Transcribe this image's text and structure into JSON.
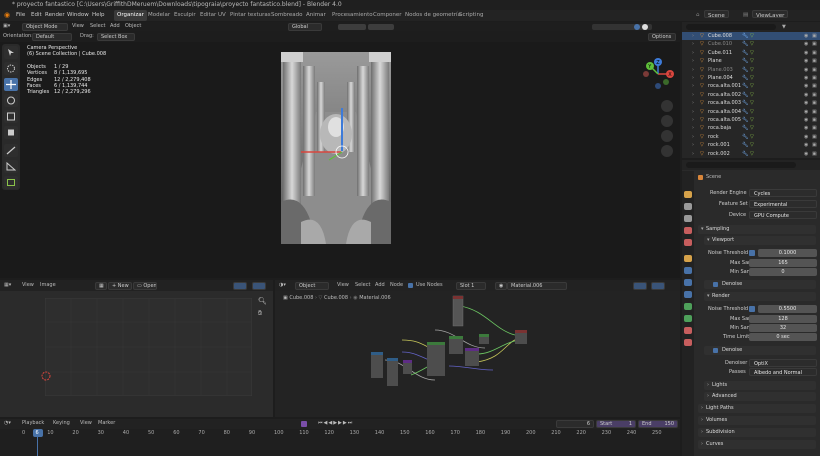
{
  "window": {
    "title": "* proyecto fantastico [C:\\Users\\GriffithDMeruem\\Downloads\\tipograia\\proyecto fantastico.blend] - Blender 4.0"
  },
  "menubar": {
    "menus": [
      "File",
      "Edit",
      "Render",
      "Window",
      "Help"
    ],
    "workspaces": [
      "Organizar",
      "Modelar",
      "Esculpir",
      "Editar UV",
      "Pintar texturas",
      "Sombreado",
      "Animar",
      "Procesamiento",
      "Componer",
      "Nodos de geometría",
      "Scripting"
    ],
    "scene": "Scene",
    "view_layer": "ViewLayer"
  },
  "viewport": {
    "mode": "Object Mode",
    "menus": [
      "View",
      "Select",
      "Add",
      "Object"
    ],
    "transform": "Global",
    "orientation_label": "Orientation:",
    "orientation_value": "Default",
    "drag_label": "Drag:",
    "drag_value": "Select Box",
    "options": "Options",
    "camera_title": "Camera Perspective",
    "camera_sub": "(6) Scene Collection | Cube.008",
    "stats": [
      {
        "label": "Objects",
        "value": "1 / 29"
      },
      {
        "label": "Vertices",
        "value": "8 / 1,139,695"
      },
      {
        "label": "Edges",
        "value": "12 / 2,279,408"
      },
      {
        "label": "Faces",
        "value": "6 / 1,139,744"
      },
      {
        "label": "Triangles",
        "value": "12 / 2,279,296"
      }
    ],
    "gizmo": {
      "x": "X",
      "y": "Y",
      "z": "Z"
    }
  },
  "outliner": {
    "items": [
      {
        "name": "Cube.008",
        "selected": true,
        "dim": false
      },
      {
        "name": "Cube.010",
        "selected": false,
        "dim": true
      },
      {
        "name": "Cube.011",
        "selected": false,
        "dim": false
      },
      {
        "name": "Plane",
        "selected": false,
        "dim": false
      },
      {
        "name": "Plane.003",
        "selected": false,
        "dim": true
      },
      {
        "name": "Plane.004",
        "selected": false,
        "dim": false
      },
      {
        "name": "roca.alta.001",
        "selected": false,
        "dim": false
      },
      {
        "name": "roca.alta.002",
        "selected": false,
        "dim": false
      },
      {
        "name": "roca.alta.003",
        "selected": false,
        "dim": false
      },
      {
        "name": "roca.alta.004",
        "selected": false,
        "dim": false
      },
      {
        "name": "roca.alta.005",
        "selected": false,
        "dim": false
      },
      {
        "name": "roca.baja",
        "selected": false,
        "dim": false
      },
      {
        "name": "rock",
        "selected": false,
        "dim": false
      },
      {
        "name": "rock.001",
        "selected": false,
        "dim": false
      },
      {
        "name": "rock.002",
        "selected": false,
        "dim": false
      }
    ]
  },
  "properties": {
    "header": "Scene",
    "render_engine_label": "Render Engine",
    "render_engine": "Cycles",
    "feature_set_label": "Feature Set",
    "feature_set": "Experimental",
    "device_label": "Device",
    "device": "GPU Compute",
    "sampling": "Sampling",
    "viewport": "Viewport",
    "noise_threshold_label": "Noise Threshold",
    "viewport_noise_threshold": "0.1000",
    "max_samples_label": "Max Samples",
    "viewport_max_samples": "165",
    "min_samples_label": "Min Samples",
    "viewport_min_samples": "0",
    "denoise": "Denoise",
    "render": "Render",
    "render_noise_threshold": "0.5500",
    "render_max_samples": "128",
    "render_min_samples": "32",
    "time_limit_label": "Time Limit",
    "time_limit": "0 sec",
    "denoiser_label": "Denoiser",
    "denoiser": "OptiX",
    "passes_label": "Passes",
    "passes": "Albedo and Normal",
    "lights": "Lights",
    "advanced": "Advanced",
    "light_paths": "Light Paths",
    "volumes": "Volumes",
    "subdivision": "Subdivision",
    "curves": "Curves"
  },
  "image_editor": {
    "menus": [
      "View",
      "Image"
    ],
    "new": "New",
    "open": "Open"
  },
  "node_editor": {
    "object": "Object",
    "menus": [
      "View",
      "Select",
      "Add",
      "Node"
    ],
    "use_nodes": "Use Nodes",
    "slot": "Slot 1",
    "material": "Material.006",
    "breadcrumb": [
      "Cube.008",
      "Cube.008",
      "Material.006"
    ]
  },
  "timeline": {
    "menus": [
      "Playback",
      "Keying",
      "View",
      "Marker"
    ],
    "current_frame": "6",
    "start_label": "Start",
    "start": "1",
    "end_label": "End",
    "end": "150",
    "ticks": [
      "0",
      "6",
      "10",
      "20",
      "30",
      "40",
      "50",
      "60",
      "70",
      "80",
      "90",
      "100",
      "110",
      "120",
      "130",
      "140",
      "150",
      "160",
      "170",
      "180",
      "190",
      "200",
      "210",
      "220",
      "230",
      "240",
      "250"
    ]
  },
  "colors": {
    "accent": "#4872a8",
    "selection": "#324e74",
    "origin": "#ff8c3a"
  }
}
